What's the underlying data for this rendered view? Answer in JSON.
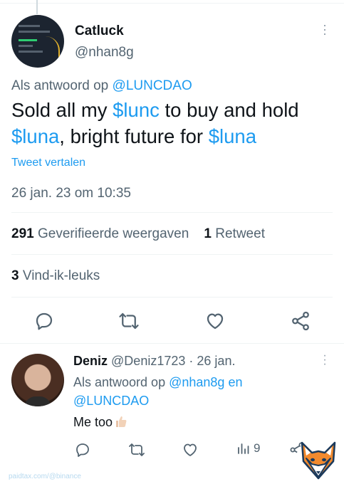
{
  "main_tweet": {
    "author": {
      "name": "Catluck",
      "handle": "@nhan8g"
    },
    "reply_prefix": "Als antwoord op",
    "reply_to": "@LUNCDAO",
    "text_parts": [
      "Sold all my ",
      "$lunc",
      " to buy and hold ",
      "$luna",
      ", bright future for ",
      "$luna"
    ],
    "translate_label": "Tweet vertalen",
    "datetime": "26 jan. 23 om 10:35",
    "views_count": "291",
    "views_label": "Geverifieerde weergaven",
    "retweets_count": "1",
    "retweets_label": "Retweet",
    "likes_count": "3",
    "likes_label": "Vind-ik-leuks"
  },
  "reply": {
    "author_name": "Deniz",
    "author_handle": "@Deniz1723",
    "separator": "·",
    "date": "26 jan.",
    "reply_prefix": "Als antwoord op",
    "reply_to_1": "@nhan8g",
    "reply_conj": "en",
    "reply_to_2": "@LUNCDAO",
    "text": "Me too",
    "views": "9"
  },
  "watermark": "paidtax.com/@binance",
  "colors": {
    "link": "#1d9bf0",
    "secondary": "#536471",
    "text": "#0f1419"
  }
}
